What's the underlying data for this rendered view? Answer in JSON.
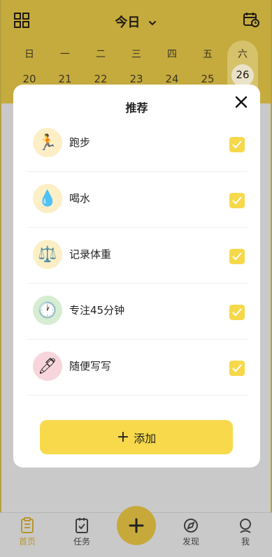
{
  "header": {
    "title": "今日"
  },
  "calendar": {
    "weekdays": [
      "日",
      "一",
      "二",
      "三",
      "四",
      "五",
      "六"
    ],
    "dates": [
      "20",
      "21",
      "22",
      "23",
      "24",
      "25",
      "26"
    ],
    "selected_index": 6
  },
  "modal": {
    "title": "推荐",
    "items": [
      {
        "label": "跑步",
        "icon": "runner-icon",
        "emoji": "🏃",
        "bg": "#fcefc6",
        "checked": true
      },
      {
        "label": "喝水",
        "icon": "water-drop-icon",
        "emoji": "💧",
        "bg": "#fcefc6",
        "checked": true
      },
      {
        "label": "记录体重",
        "icon": "scale-icon",
        "emoji": "⚖️",
        "bg": "#fcefc6",
        "checked": true
      },
      {
        "label": "专注45分钟",
        "icon": "clock-icon",
        "emoji": "🕐",
        "bg": "#d7edd2",
        "checked": true
      },
      {
        "label": "随便写写",
        "icon": "pen-icon",
        "emoji": "🖊",
        "bg": "#f8d5dd",
        "checked": true
      }
    ],
    "add_label": "添加"
  },
  "nav": {
    "items": [
      {
        "label": "首页",
        "icon": "home-doc-icon",
        "active": true
      },
      {
        "label": "任务",
        "icon": "task-icon",
        "active": false
      },
      {
        "label": "发现",
        "icon": "compass-icon",
        "active": false
      },
      {
        "label": "我",
        "icon": "profile-icon",
        "active": false
      }
    ]
  },
  "colors": {
    "accent": "#f7d94b",
    "dim_accent": "#c5ab3e",
    "overlay": "#c9c9c9"
  }
}
